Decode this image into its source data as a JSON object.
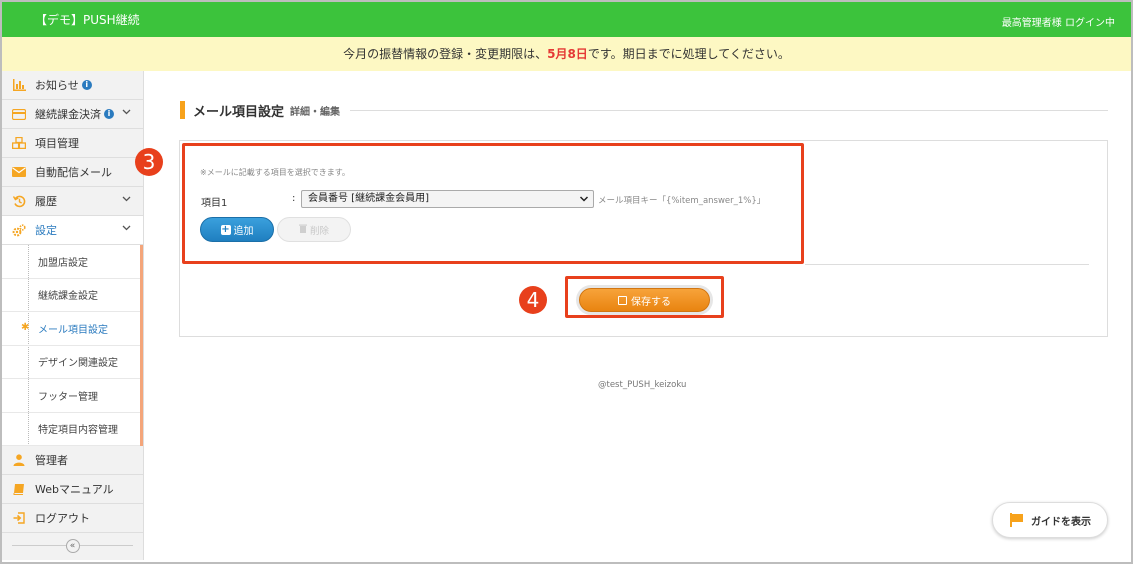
{
  "app": {
    "title": "【デモ】PUSH継続",
    "login_status": "最高管理者様 ログイン中"
  },
  "notice": {
    "prefix": "今月の振替情報の登録・変更期限は、",
    "deadline": "5月8日",
    "suffix": "です。期日までに処理してください。"
  },
  "sidebar": {
    "items": [
      {
        "label": "お知らせ",
        "icon": "bar-chart-icon"
      },
      {
        "label": "継続課金決済",
        "icon": "credit-card-icon"
      },
      {
        "label": "項目管理",
        "icon": "cubes-icon"
      },
      {
        "label": "自動配信メール",
        "icon": "envelope-icon"
      },
      {
        "label": "履歴",
        "icon": "history-icon"
      },
      {
        "label": "設定",
        "icon": "gears-icon"
      },
      {
        "label": "管理者",
        "icon": "user-icon"
      },
      {
        "label": "Webマニュアル",
        "icon": "book-icon"
      },
      {
        "label": "ログアウト",
        "icon": "sign-out-icon"
      }
    ],
    "settings_submenu": [
      {
        "label": "加盟店設定"
      },
      {
        "label": "継続課金設定"
      },
      {
        "label": "メール項目設定"
      },
      {
        "label": "デザイン関連設定"
      },
      {
        "label": "フッター管理"
      },
      {
        "label": "特定項目内容管理"
      }
    ],
    "collapse_label": "«"
  },
  "main": {
    "heading": "メール項目設定",
    "heading_sub": "詳細・編集",
    "hint": "※メールに記載する項目を選択できます。",
    "row": {
      "label": "項目1",
      "colon": ":",
      "selected_option": "会員番号 [継続課金会員用]",
      "key_note": "メール項目キー「{%item_answer_1%}」"
    },
    "add_label": "追加",
    "delete_label": "削除",
    "save_label": "保存する",
    "footer_user": "@test_PUSH_keizoku",
    "guide_label": "ガイドを表示"
  },
  "annotations": {
    "step3": "3",
    "step4": "4"
  },
  "colors": {
    "topbar": "#3cc33c",
    "notice_bg": "#fdf8c3",
    "accent_orange": "#f7a21b",
    "annotation_red": "#e8401c",
    "primary_blue": "#1f7fc0"
  }
}
